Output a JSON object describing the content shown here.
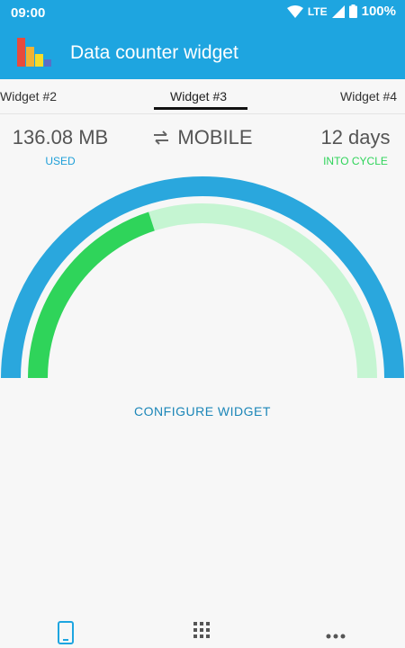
{
  "status_bar": {
    "time": "09:00",
    "network": "LTE",
    "battery": "100%"
  },
  "app_bar": {
    "title": "Data counter widget"
  },
  "tabs": [
    {
      "label": "Widget #2"
    },
    {
      "label": "Widget #3"
    },
    {
      "label": "Widget #4"
    }
  ],
  "selected_tab": "Widget #3",
  "stats": {
    "used": {
      "value": "136.08 MB",
      "caption": "USED"
    },
    "type": {
      "value": "MOBILE"
    },
    "cycle": {
      "value": "12 days",
      "caption": "INTO CYCLE"
    }
  },
  "gauge": {
    "cycle_progress": 0.4,
    "colors": {
      "outer": "#2aa7dd",
      "used": "#2fd45a",
      "remaining": "#c5f5d2"
    }
  },
  "configure": {
    "label": "CONFIGURE WIDGET"
  },
  "bottom_nav": [
    {
      "icon": "phone-icon"
    },
    {
      "icon": "grid-icon"
    },
    {
      "icon": "more-icon"
    }
  ],
  "colors": {
    "primary": "#1ea5e0",
    "used_caption": "#1e9fd8",
    "cycle_caption": "#2fd45a"
  }
}
